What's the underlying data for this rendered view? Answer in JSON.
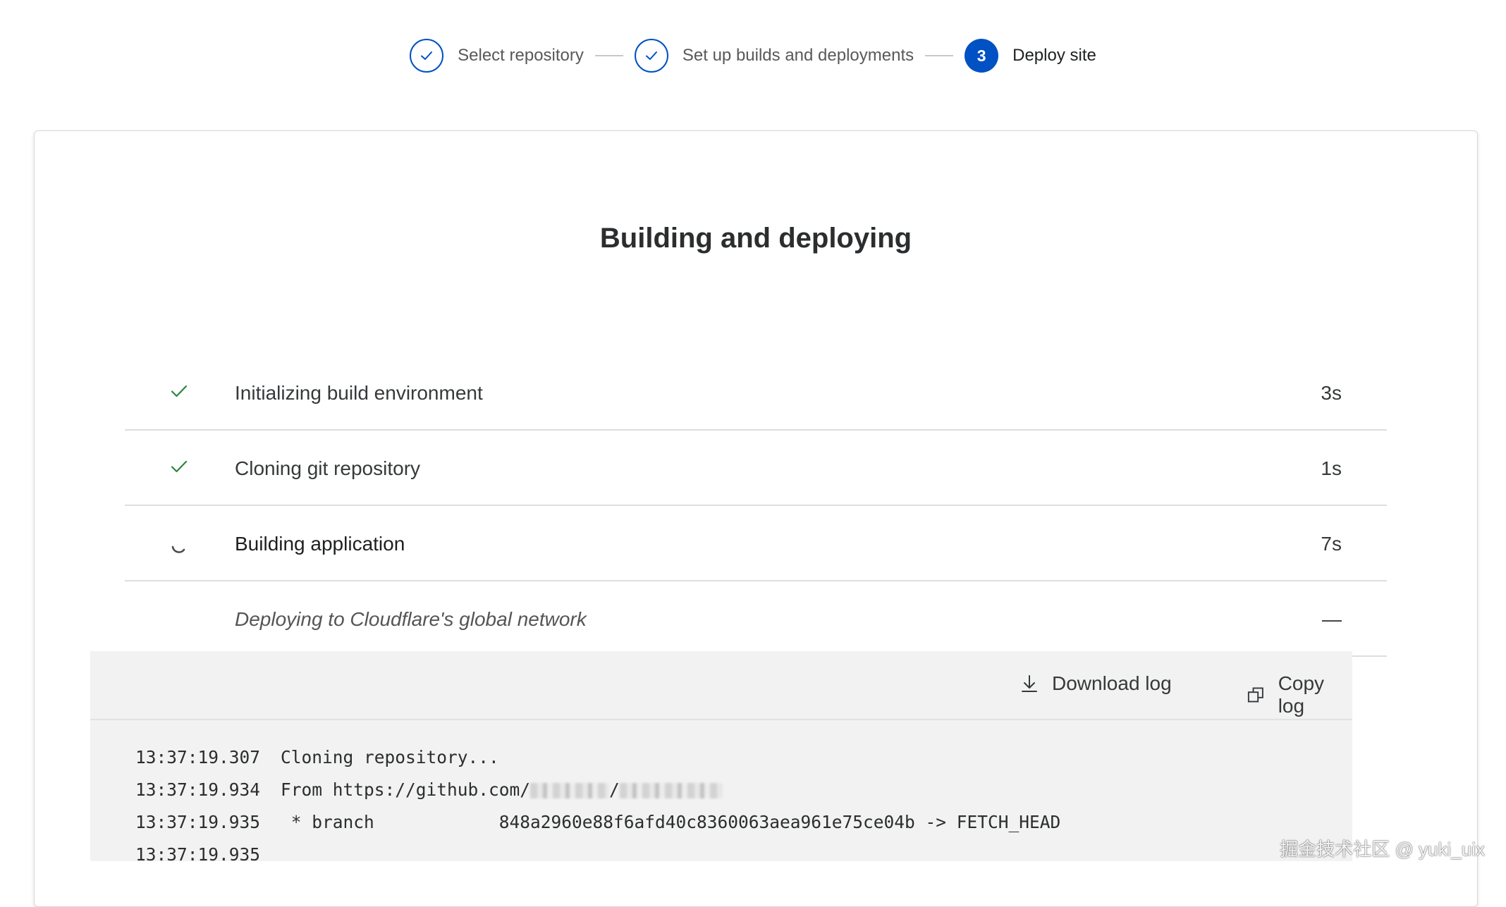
{
  "stepper": {
    "steps": [
      {
        "label": "Select repository",
        "state": "done"
      },
      {
        "label": "Set up builds and deployments",
        "state": "done"
      },
      {
        "label": "Deploy site",
        "number": "3",
        "state": "active"
      }
    ]
  },
  "card": {
    "title": "Building and deploying",
    "rows": [
      {
        "label": "Initializing build environment",
        "time": "3s",
        "status": "done"
      },
      {
        "label": "Cloning git repository",
        "time": "1s",
        "status": "done"
      },
      {
        "label": "Building application",
        "time": "7s",
        "status": "in-progress"
      },
      {
        "label": "Deploying to Cloudflare's global network",
        "time": "—",
        "status": "pending"
      }
    ]
  },
  "log": {
    "download_label": "Download log",
    "copy_label": "Copy log",
    "lines": [
      {
        "time": "13:37:19.307",
        "text": "Cloning repository..."
      },
      {
        "time": "13:37:19.934",
        "text": "From https://github.com/"
      },
      {
        "time": "13:37:19.935",
        "text": " * branch            848a2960e88f6afd40c8360063aea961e75ce04b -> FETCH_HEAD"
      },
      {
        "time": "13:37:19.935",
        "text": ""
      }
    ],
    "separator": "/"
  },
  "watermark": "掘金技术社区 @ yuki_uix",
  "colors": {
    "accent": "#0051c3",
    "success": "#2e8540",
    "log_bg": "#f2f2f2"
  },
  "icons": {
    "done_step": "check-icon",
    "done_row": "check-icon",
    "in_progress_row": "spinner-icon",
    "download": "download-icon",
    "copy": "copy-icon"
  }
}
